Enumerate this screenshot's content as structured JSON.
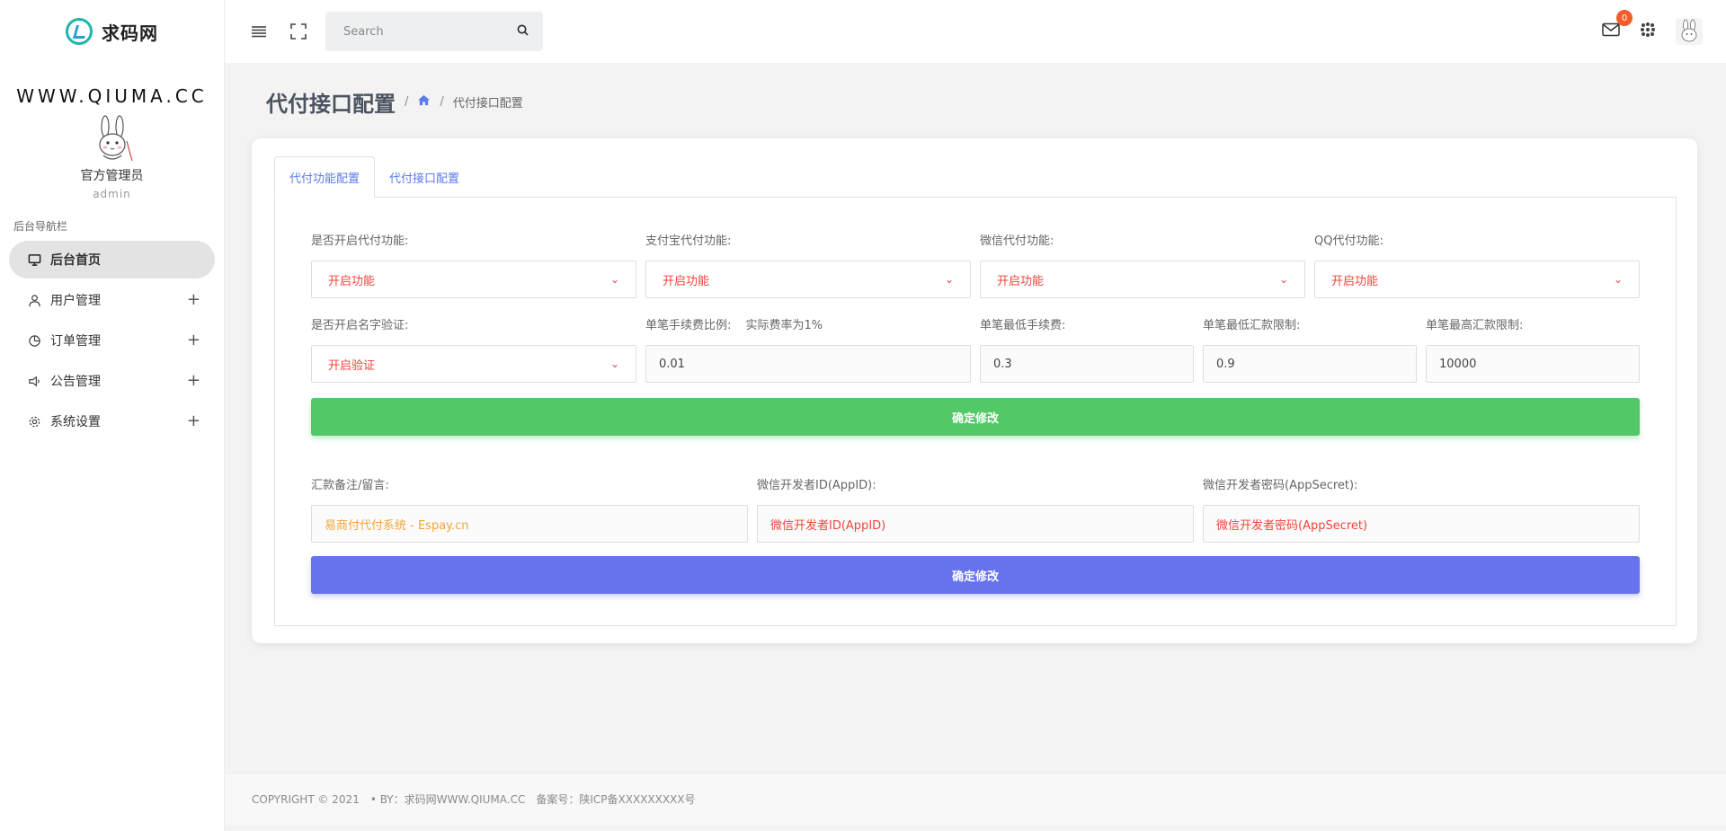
{
  "brand": {
    "name": "求码网",
    "url_text": "WWW.QIUMA.CC"
  },
  "profile": {
    "name": "官方管理员",
    "role": "admin"
  },
  "sidebar": {
    "section_title": "后台导航栏",
    "items": [
      {
        "label": "后台首页",
        "icon": "monitor-icon",
        "active": true
      },
      {
        "label": "用户管理",
        "icon": "user-icon",
        "expandable": "+"
      },
      {
        "label": "订单管理",
        "icon": "pie-chart-icon",
        "expandable": "+"
      },
      {
        "label": "公告管理",
        "icon": "megaphone-icon",
        "expandable": "+"
      },
      {
        "label": "系统设置",
        "icon": "gear-icon",
        "expandable": "+"
      }
    ]
  },
  "header": {
    "search_placeholder": "Search",
    "mail_badge": "0"
  },
  "page": {
    "title": "代付接口配置",
    "breadcrumb_sep": "/",
    "breadcrumb_current": "代付接口配置"
  },
  "tabs": [
    {
      "label": "代付功能配置",
      "active": true
    },
    {
      "label": "代付接口配置"
    }
  ],
  "form1": {
    "row1": [
      {
        "label": "是否开启代付功能:",
        "value": "开启功能"
      },
      {
        "label": "支付宝代付功能:",
        "value": "开启功能"
      },
      {
        "label": "微信代付功能:",
        "value": "开启功能"
      },
      {
        "label": "QQ代付功能:",
        "value": "开启功能"
      }
    ],
    "row2": {
      "verify_label": "是否开启名字验证:",
      "verify_value": "开启验证",
      "fee_ratio_label": "单笔手续费比例:",
      "fee_ratio_note": "实际费率为1%",
      "fee_ratio_value": "0.01",
      "min_fee_label": "单笔最低手续费:",
      "min_fee_value": "0.3",
      "min_amount_label": "单笔最低汇款限制:",
      "min_amount_value": "0.9",
      "max_amount_label": "单笔最高汇款限制:",
      "max_amount_value": "10000"
    },
    "submit_label": "确定修改"
  },
  "form2": {
    "remark_label": "汇款备注/留言:",
    "remark_value": "易商付代付系统 - Espay.cn",
    "appid_label": "微信开发者ID(AppID):",
    "appid_placeholder": "微信开发者ID(AppID)",
    "secret_label": "微信开发者密码(AppSecret):",
    "secret_placeholder": "微信开发者密码(AppSecret)",
    "submit_label": "确定修改"
  },
  "footer": {
    "copyright": "COPYRIGHT © 2021",
    "by": "• BY：求码网WWW.QIUMA.CC",
    "icp": "备案号：陕ICP备XXXXXXXXX号"
  },
  "colors": {
    "accent_blue": "#6673ec",
    "accent_green": "#53c866",
    "select_text": "#f0443c",
    "badge": "#f25b2a"
  }
}
